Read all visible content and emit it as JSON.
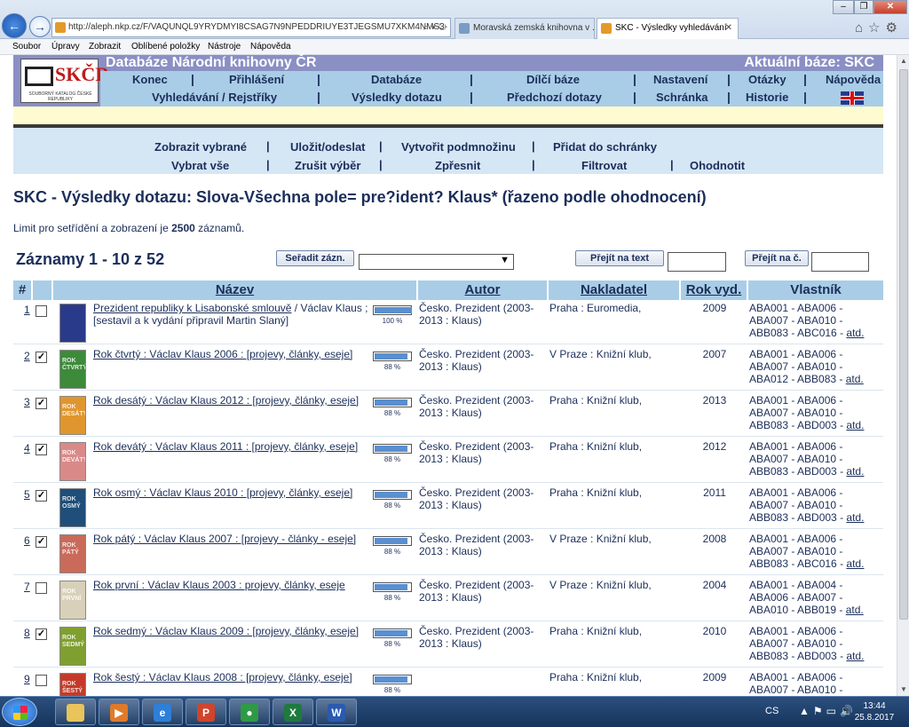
{
  "browser": {
    "url": "http://aleph.nkp.cz/F/VAQUNQL9YRYDMYI8CSAG7N9NPEDDRIUYE3TJEGSMU7XKM4NMS3-",
    "tabs": [
      {
        "label": "Moravská zemská knihovna v ..."
      },
      {
        "label": "SKC - Výsledky vyhledávání"
      }
    ],
    "menu": [
      "Soubor",
      "Úpravy",
      "Zobrazit",
      "Oblíbené položky",
      "Nástroje",
      "Nápověda"
    ]
  },
  "header": {
    "logo_text": "SKČR",
    "logo_sub": "SOUBORNÝ KATALOG ČESKÉ REPUBLIKY",
    "title": "Databáze Národní knihovny ČR",
    "current_base": "Aktuální báze:  SKC",
    "nav1": [
      "Konec",
      "Přihlášení",
      "Databáze",
      "Dílčí báze",
      "Nastavení",
      "Otázky",
      "Nápověda"
    ],
    "nav2": [
      "Vyhledávání / Rejstříky",
      "Výsledky dotazu",
      "Předchozí dotazy",
      "Schránka",
      "Historie"
    ]
  },
  "actions": {
    "row1": [
      "Zobrazit vybrané",
      "Uložit/odeslat",
      "Vytvořit podmnožinu",
      "Přidat do schránky"
    ],
    "row2": [
      "Vybrat vše",
      "Zrušit výběr",
      "Zpřesnit",
      "Filtrovat",
      "Ohodnotit"
    ]
  },
  "results": {
    "title": "SKC - Výsledky dotazu:  Slova-Všechna pole= pre?ident? Klaus*  (řazeno podle ohodnocení)",
    "limit_prefix": "Limit pro setřídění a zobrazení je ",
    "limit_value": "2500",
    "limit_suffix": " záznamů.",
    "records": "Záznamy 1 - 10 z 52",
    "sort_button": "Seřadit zázn.",
    "goto_text_button": "Přejít na text",
    "goto_num_button": "Přejít na č."
  },
  "table": {
    "headers": {
      "num": "#",
      "title": "Název",
      "author": "Autor",
      "publisher": "Nakladatel",
      "year": "Rok vyd.",
      "owner": "Vlastník"
    },
    "more_label": "atd.",
    "rows": [
      {
        "num": "1",
        "checked": false,
        "title_link": "Prezident republiky k Lisabonské smlouvě",
        "title_rest": " / Václav Klaus ; [sestavil a k vydání připravil Martin Slaný]",
        "relevance": 100,
        "relevance_label": "100 %",
        "author": "Česko. Prezident (2003-2013 : Klaus)",
        "publisher": "Praha : Euromedia,",
        "year": "2009",
        "owner": "ABA001 - ABA006 - ABA007 - ABA010 - ABB083 - ABC016 - ",
        "cover_color": "#2a3a8a",
        "cover_text": ""
      },
      {
        "num": "2",
        "checked": true,
        "title_link": "Rok čtvrtý : Václav Klaus 2006 : [projevy, články, eseje]",
        "title_rest": "",
        "relevance": 88,
        "relevance_label": "88 %",
        "author": "Česko. Prezident (2003-2013 : Klaus)",
        "publisher": "V Praze : Knižní klub,",
        "year": "2007",
        "owner": "ABA001 - ABA006 - ABA007 - ABA010 - ABA012 - ABB083 - ",
        "cover_color": "#3d8a3a",
        "cover_text": "ROK ČTVRTÝ"
      },
      {
        "num": "3",
        "checked": true,
        "title_link": "Rok desátý : Václav Klaus 2012 : [projevy, články, eseje]",
        "title_rest": "",
        "relevance": 88,
        "relevance_label": "88 %",
        "author": "Česko. Prezident (2003-2013 : Klaus)",
        "publisher": "Praha : Knižní klub,",
        "year": "2013",
        "owner": "ABA001 - ABA006 - ABA007 - ABA010 - ABB083 - ABD003 - ",
        "cover_color": "#e0962e",
        "cover_text": "ROK DESÁTÝ"
      },
      {
        "num": "4",
        "checked": true,
        "title_link": "Rok devátý : Václav Klaus 2011 : [projevy, články, eseje]",
        "title_rest": "",
        "relevance": 88,
        "relevance_label": "88 %",
        "author": "Česko. Prezident (2003-2013 : Klaus)",
        "publisher": "Praha : Knižní klub,",
        "year": "2012",
        "owner": "ABA001 - ABA006 - ABA007 - ABA010 - ABB083 - ABD003 - ",
        "cover_color": "#d98a88",
        "cover_text": "ROK DEVÁTÝ"
      },
      {
        "num": "5",
        "checked": true,
        "title_link": "Rok osmý : Václav Klaus 2010 : [projevy, články, eseje]",
        "title_rest": "",
        "relevance": 88,
        "relevance_label": "88 %",
        "author": "Česko. Prezident (2003-2013 : Klaus)",
        "publisher": "Praha : Knižní klub,",
        "year": "2011",
        "owner": "ABA001 - ABA006 - ABA007 - ABA010 - ABB083 - ABD003 - ",
        "cover_color": "#1f4e7a",
        "cover_text": "ROK OSMÝ"
      },
      {
        "num": "6",
        "checked": true,
        "title_link": "Rok pátý : Václav Klaus 2007 : [projevy - články - eseje]",
        "title_rest": "",
        "relevance": 88,
        "relevance_label": "88 %",
        "author": "Česko. Prezident (2003-2013 : Klaus)",
        "publisher": "V Praze : Knižní klub,",
        "year": "2008",
        "owner": "ABA001 - ABA006 - ABA007 - ABA010 - ABB083 - ABC016 - ",
        "cover_color": "#c96a5a",
        "cover_text": "ROK PÁTÝ"
      },
      {
        "num": "7",
        "checked": false,
        "title_link": "Rok první : Václav Klaus 2003 : projevy, články, eseje",
        "title_rest": "",
        "relevance": 88,
        "relevance_label": "88 %",
        "author": "Česko. Prezident (2003-2013 : Klaus)",
        "publisher": "V Praze : Knižní klub,",
        "year": "2004",
        "owner": "ABA001 - ABA004 - ABA006 - ABA007 - ABA010 - ABB019 - ",
        "cover_color": "#d8d0b8",
        "cover_text": "ROK PRVNÍ"
      },
      {
        "num": "8",
        "checked": true,
        "title_link": "Rok sedmý : Václav Klaus 2009 : [projevy, články, eseje]",
        "title_rest": "",
        "relevance": 88,
        "relevance_label": "88 %",
        "author": "Česko. Prezident (2003-2013 : Klaus)",
        "publisher": "Praha : Knižní klub,",
        "year": "2010",
        "owner": "ABA001 - ABA006 - ABA007 - ABA010 - ABB083 - ABD003 - ",
        "cover_color": "#7fa030",
        "cover_text": "ROK SEDMÝ"
      },
      {
        "num": "9",
        "checked": false,
        "title_link": "Rok šestý : Václav Klaus 2008 : [projevy, články, eseje]",
        "title_rest": "",
        "relevance": 88,
        "relevance_label": "88 %",
        "author": "",
        "publisher": "Praha : Knižní klub,",
        "year": "2009",
        "owner": "ABA001 - ABA006 - ABA007 - ABA010 - ",
        "cover_color": "#c43a2a",
        "cover_text": "ROK ŠESTÝ"
      }
    ]
  },
  "taskbar": {
    "lang": "CS",
    "time": "13:44",
    "date": "25.8.2017",
    "apps": [
      {
        "name": "explorer",
        "color": "#e8c45a",
        "glyph": ""
      },
      {
        "name": "media",
        "color": "#e07a2a",
        "glyph": "▶"
      },
      {
        "name": "ie",
        "color": "#2f7fd8",
        "glyph": "e"
      },
      {
        "name": "powerpoint",
        "color": "#d0442c",
        "glyph": "P"
      },
      {
        "name": "chrome",
        "color": "#2e9a45",
        "glyph": "●"
      },
      {
        "name": "excel",
        "color": "#1f7a3e",
        "glyph": "X"
      },
      {
        "name": "word",
        "color": "#2a5ab0",
        "glyph": "W"
      }
    ]
  }
}
